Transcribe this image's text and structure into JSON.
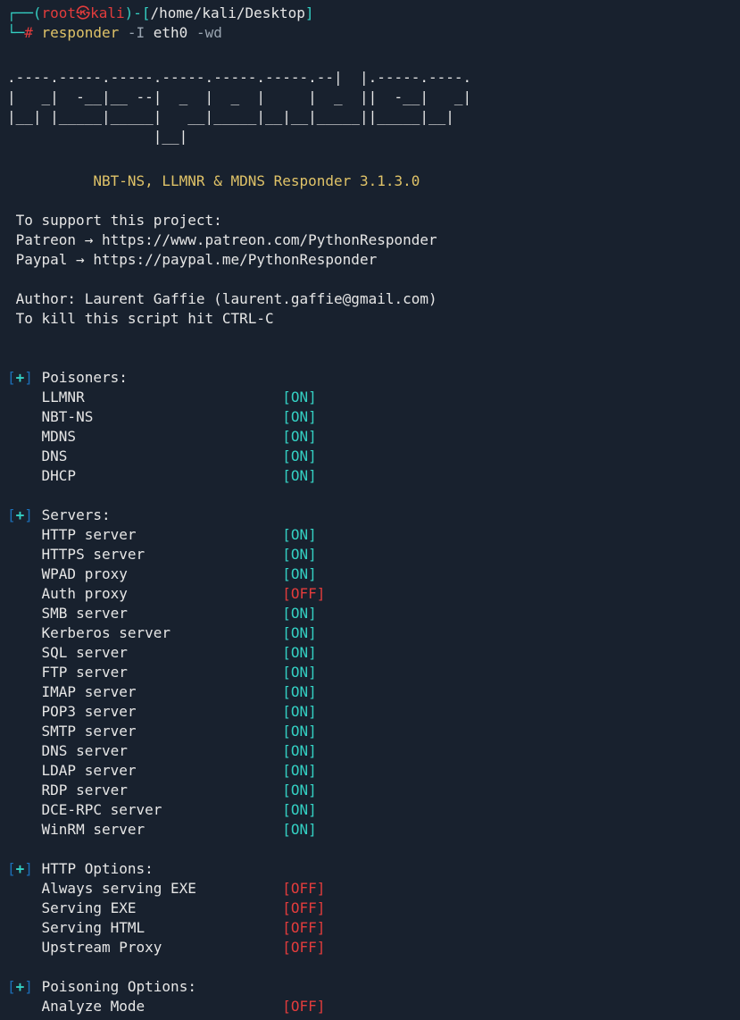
{
  "prompt": {
    "open_bracket": "┌──(",
    "user": "root",
    "at": "㉿",
    "host": "kali",
    "close_user": ")-[",
    "path": "/home/kali/Desktop",
    "close_path": "]",
    "line2_prefix": "└─# ",
    "cmd": "responder ",
    "flag1": "-I ",
    "arg1": "eth0 ",
    "flag2": "-wd"
  },
  "ascii": ".----.-----.-----.-----.-----.-----.--|  |.-----.----.\n|   _|  -__|__ --|  _  |  _  |     |  _  ||  -__|   _|\n|__| |_____|_____|   __|_____|__|__|_____||_____|__|\n                 |__|",
  "title": "NBT-NS, LLMNR & MDNS Responder 3.1.3.0",
  "support": {
    "l1": "To support this project:",
    "l2": "Patreon → https://www.patreon.com/PythonResponder",
    "l3": "Paypal  → https://paypal.me/PythonResponder",
    "l4": "Author: Laurent Gaffie (laurent.gaffie@gmail.com)",
    "l5": "To kill this script hit CTRL-C"
  },
  "sections": {
    "poisoners": {
      "title": "Poisoners:",
      "rows": [
        {
          "label": "LLMNR",
          "status": "[ON]",
          "cls": "on"
        },
        {
          "label": "NBT-NS",
          "status": "[ON]",
          "cls": "on"
        },
        {
          "label": "MDNS",
          "status": "[ON]",
          "cls": "on"
        },
        {
          "label": "DNS",
          "status": "[ON]",
          "cls": "on"
        },
        {
          "label": "DHCP",
          "status": "[ON]",
          "cls": "on"
        }
      ]
    },
    "servers": {
      "title": "Servers:",
      "rows": [
        {
          "label": "HTTP server",
          "status": "[ON]",
          "cls": "on"
        },
        {
          "label": "HTTPS server",
          "status": "[ON]",
          "cls": "on"
        },
        {
          "label": "WPAD proxy",
          "status": "[ON]",
          "cls": "on"
        },
        {
          "label": "Auth proxy",
          "status": "[OFF]",
          "cls": "off"
        },
        {
          "label": "SMB server",
          "status": "[ON]",
          "cls": "on"
        },
        {
          "label": "Kerberos server",
          "status": "[ON]",
          "cls": "on"
        },
        {
          "label": "SQL server",
          "status": "[ON]",
          "cls": "on"
        },
        {
          "label": "FTP server",
          "status": "[ON]",
          "cls": "on"
        },
        {
          "label": "IMAP server",
          "status": "[ON]",
          "cls": "on"
        },
        {
          "label": "POP3 server",
          "status": "[ON]",
          "cls": "on"
        },
        {
          "label": "SMTP server",
          "status": "[ON]",
          "cls": "on"
        },
        {
          "label": "DNS server",
          "status": "[ON]",
          "cls": "on"
        },
        {
          "label": "LDAP server",
          "status": "[ON]",
          "cls": "on"
        },
        {
          "label": "RDP server",
          "status": "[ON]",
          "cls": "on"
        },
        {
          "label": "DCE-RPC server",
          "status": "[ON]",
          "cls": "on"
        },
        {
          "label": "WinRM server",
          "status": "[ON]",
          "cls": "on"
        }
      ]
    },
    "http": {
      "title": "HTTP Options:",
      "rows": [
        {
          "label": "Always serving EXE",
          "status": "[OFF]",
          "cls": "off"
        },
        {
          "label": "Serving EXE",
          "status": "[OFF]",
          "cls": "off"
        },
        {
          "label": "Serving HTML",
          "status": "[OFF]",
          "cls": "off"
        },
        {
          "label": "Upstream Proxy",
          "status": "[OFF]",
          "cls": "off"
        }
      ]
    },
    "poisoning": {
      "title": "Poisoning Options:",
      "rows": [
        {
          "label": "Analyze Mode",
          "status": "[OFF]",
          "cls": "off"
        }
      ]
    }
  },
  "plus": "[+]",
  "indent": "    "
}
